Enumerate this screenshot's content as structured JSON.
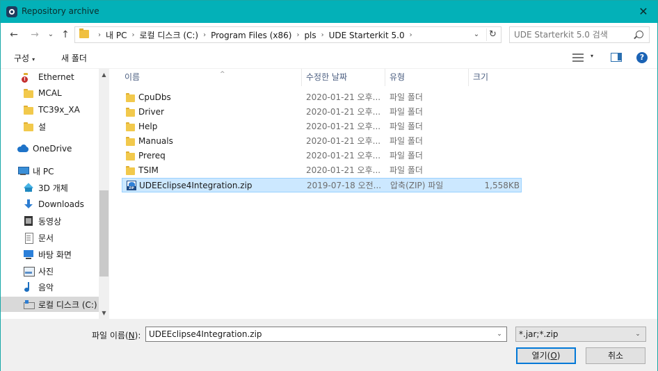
{
  "window": {
    "title": "Repository archive",
    "close_glyph": "✕"
  },
  "nav": {
    "back_glyph": "←",
    "forward_glyph": "→",
    "recent_glyph": "⌄",
    "up_glyph": "↑",
    "breadcrumbs": [
      "내 PC",
      "로컬 디스크 (C:)",
      "Program Files (x86)",
      "pls",
      "UDE Starterkit 5.0"
    ],
    "separator": "›",
    "dropdown_glyph": "⌄",
    "refresh_glyph": "↻",
    "search_placeholder": "UDE Starterkit 5.0 검색"
  },
  "toolbar": {
    "organize_label": "구성",
    "new_folder_label": "새 폴더",
    "caret": "▾",
    "help_label": "?"
  },
  "sidebar": {
    "items": [
      {
        "label": "Ethernet",
        "icon": "folder-warning-icon"
      },
      {
        "label": "MCAL",
        "icon": "folder-icon"
      },
      {
        "label": "TC39x_XA",
        "icon": "folder-icon"
      },
      {
        "label": "설",
        "icon": "folder-icon"
      },
      {
        "label": "OneDrive",
        "icon": "onedrive-icon"
      },
      {
        "label": "내 PC",
        "icon": "this-pc-icon"
      },
      {
        "label": "3D 개체",
        "icon": "3d-objects-icon"
      },
      {
        "label": "Downloads",
        "icon": "downloads-icon"
      },
      {
        "label": "동영상",
        "icon": "videos-icon"
      },
      {
        "label": "문서",
        "icon": "documents-icon"
      },
      {
        "label": "바탕 화면",
        "icon": "desktop-icon"
      },
      {
        "label": "사진",
        "icon": "pictures-icon"
      },
      {
        "label": "음악",
        "icon": "music-icon"
      },
      {
        "label": "로컬 디스크 (C:)",
        "icon": "local-disk-icon",
        "selected": true
      }
    ],
    "scroll_up": "▲",
    "scroll_down": "▼"
  },
  "filelist": {
    "columns": [
      "이름",
      "수정한 날짜",
      "유형",
      "크기"
    ],
    "sort_glyph": "^",
    "rows": [
      {
        "name": "CpuDbs",
        "date": "2020-01-21 오후...",
        "type": "파일 폴더",
        "size": "",
        "icon": "folder-icon"
      },
      {
        "name": "Driver",
        "date": "2020-01-21 오후...",
        "type": "파일 폴더",
        "size": "",
        "icon": "folder-icon"
      },
      {
        "name": "Help",
        "date": "2020-01-21 오후...",
        "type": "파일 폴더",
        "size": "",
        "icon": "folder-icon"
      },
      {
        "name": "Manuals",
        "date": "2020-01-21 오후...",
        "type": "파일 폴더",
        "size": "",
        "icon": "folder-icon"
      },
      {
        "name": "Prereq",
        "date": "2020-01-21 오후...",
        "type": "파일 폴더",
        "size": "",
        "icon": "folder-icon"
      },
      {
        "name": "TSIM",
        "date": "2020-01-21 오후...",
        "type": "파일 폴더",
        "size": "",
        "icon": "folder-icon"
      },
      {
        "name": "UDEEclipse4Integration.zip",
        "date": "2019-07-18 오전...",
        "type": "압축(ZIP) 파일",
        "size": "1,558KB",
        "icon": "zip-file-icon",
        "selected": true
      }
    ]
  },
  "footer": {
    "filename_label_pre": "파일 이름(",
    "filename_label_key": "N",
    "filename_label_post": "):",
    "filename_value": "UDEEclipse4Integration.zip",
    "dropdown_glyph": "⌄",
    "filter_value": "*.jar;*.zip",
    "open_label_pre": "열기(",
    "open_label_key": "O",
    "open_label_post": ")",
    "cancel_label": "취소"
  },
  "colors": {
    "titlebar": "#03b1b8",
    "selection": "#cce8ff",
    "accent": "#0078d7"
  }
}
